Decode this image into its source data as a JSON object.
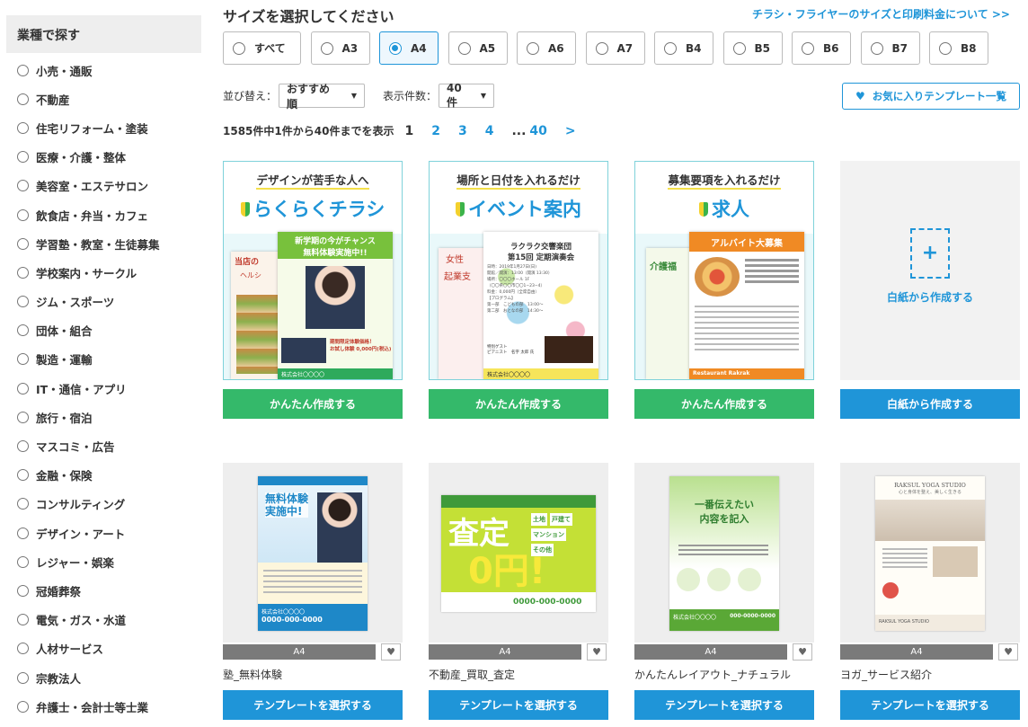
{
  "sidebar": {
    "heading": "業種で探す",
    "items": [
      "小売・通販",
      "不動産",
      "住宅リフォーム・塗装",
      "医療・介護・整体",
      "美容室・エステサロン",
      "飲食店・弁当・カフェ",
      "学習塾・教室・生徒募集",
      "学校案内・サークル",
      "ジム・スポーツ",
      "団体・組合",
      "製造・運輸",
      "IT・通信・アプリ",
      "旅行・宿泊",
      "マスコミ・広告",
      "金融・保険",
      "コンサルティング",
      "デザイン・アート",
      "レジャー・娯楽",
      "冠婚葬祭",
      "電気・ガス・水道",
      "人材サービス",
      "宗教法人",
      "弁護士・会計士等士業"
    ]
  },
  "size_section": {
    "title": "サイズを選択してください",
    "link": "チラシ・フライヤーのサイズと印刷料金について >>",
    "options": [
      "すべて",
      "A3",
      "A4",
      "A5",
      "A6",
      "A7",
      "B4",
      "B5",
      "B6",
      "B7",
      "B8"
    ],
    "selected": "A4"
  },
  "sort": {
    "label": "並び替え：",
    "value": "おすすめ順",
    "count_label": "表示件数：",
    "count_value": "40件",
    "favorites_button": "お気に入りテンプレート一覧"
  },
  "pagination": {
    "summary": "1585件中1件から40件までを表示",
    "pages": [
      "1",
      "2",
      "3",
      "4"
    ],
    "ellipsis": "...",
    "last": "40",
    "next": ">"
  },
  "featured": [
    {
      "subtitle": "デザインが苦手な人へ",
      "title": "らくらくチラシ",
      "button": "かんたん作成する",
      "flyer_lines": [
        "新学期の今がチャンス",
        "無料体験実施中!!",
        "当店の",
        "ヘルシ",
        "期間限定体験価格！",
        "お試し体験 0,000円(税込)",
        "株式会社〇〇〇〇"
      ]
    },
    {
      "subtitle": "場所と日付を入れるだけ",
      "title": "イベント案内",
      "button": "かんたん作成する",
      "flyer_lines": [
        "ラクラク交響楽団",
        "第15回 定期演奏会",
        "日時：2019年1月27日(日)",
        "開館／開演：13:00（開演 13:30）",
        "場所：〇〇〇ホール 1F",
        "（〇〇県〇〇市〇〇1−23−4）",
        "料金：0,000円（全席自由）",
        "【プログラム】",
        "第一部　こどもの部　13:00〜",
        "第二部　おとなの部　14:30〜",
        "特別ゲスト",
        "ピアニスト　名字 太郎 氏",
        "株式会社〇〇〇〇",
        "女性",
        "起業支"
      ]
    },
    {
      "subtitle": "募集要項を入れるだけ",
      "title": "求人",
      "button": "かんたん作成する",
      "flyer_lines": [
        "アルバイト大募集",
        "介護福",
        "Restaurant Rakrak"
      ]
    }
  ],
  "blank": {
    "plus": "+",
    "label": "白紙から作成する",
    "button": "白紙から作成する"
  },
  "templates": [
    {
      "size": "A4",
      "name": "塾_無料体験",
      "button": "テンプレートを選択する",
      "flyer_lines": [
        "無料体験",
        "実施中!",
        "株式会社〇〇〇〇",
        "0000-000-0000"
      ]
    },
    {
      "size": "A4",
      "name": "不動産_買取_査定",
      "button": "テンプレートを選択する",
      "flyer_lines": [
        "査定",
        "0円!",
        "土地",
        "戸建て",
        "マンション",
        "その他",
        "0000-000-0000"
      ]
    },
    {
      "size": "A4",
      "name": "かんたんレイアウト_ナチュラル",
      "button": "テンプレートを選択する",
      "flyer_lines": [
        "一番伝えたい",
        "内容を記入",
        "株式会社〇〇〇〇",
        "000-0000-0000"
      ]
    },
    {
      "size": "A4",
      "name": "ヨガ_サービス紹介",
      "button": "テンプレートを選択する",
      "flyer_lines": [
        "RAKSUL YOGA STUDIO",
        "心と身体を整え、美しく生きる",
        "RAKSUL YOGA STUDIO"
      ]
    }
  ],
  "colors": {
    "accent_blue": "#1f95d8",
    "green": "#34b96a",
    "sidebar_head_bg": "#eeeeee"
  },
  "icons": {
    "heart": "heart-icon",
    "caret": "chevron-down-icon",
    "leaf": "beginner-mark-icon"
  }
}
